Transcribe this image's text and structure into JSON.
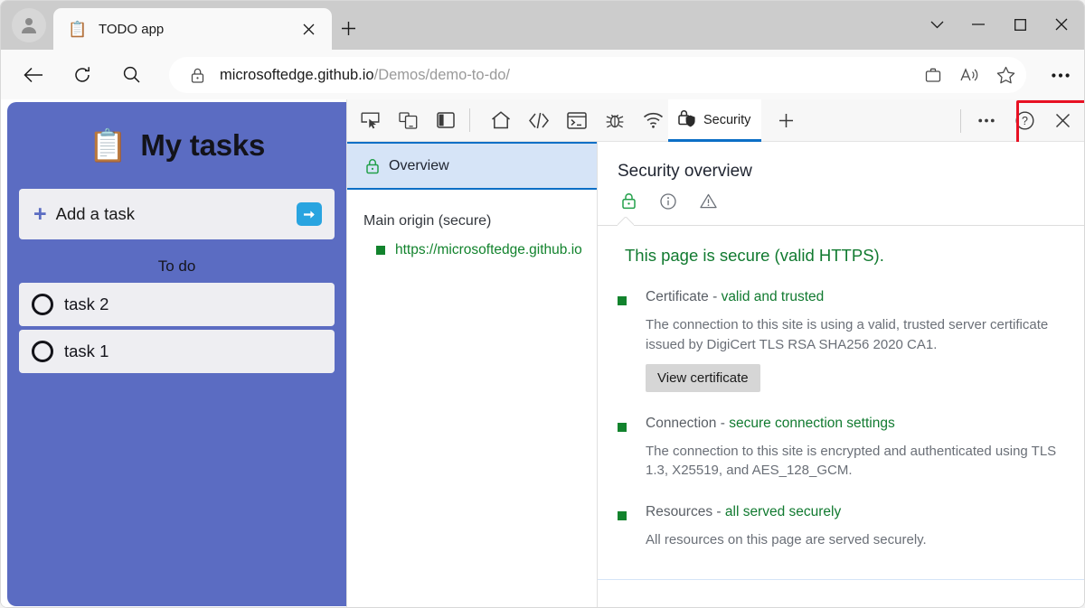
{
  "browser": {
    "profile_icon": "account-avatar-icon",
    "tab": {
      "favicon": "clipboard-icon",
      "title": "TODO app",
      "close_icon": "close-icon"
    },
    "new_tab_label": "+",
    "window_controls": {
      "more_label": "chevron-down-icon",
      "minimize_label": "minimize-icon",
      "maximize_label": "maximize-icon",
      "close_label": "close-icon"
    },
    "toolbar": {
      "back_icon": "back-arrow-icon",
      "reload_icon": "reload-icon",
      "search_icon": "search-icon",
      "url_host": "microsoftedge.github.io",
      "url_path": "/Demos/demo-to-do/",
      "site_lock_icon": "lock-icon",
      "collections_icon": "collections-icon",
      "read_aloud_icon": "read-aloud-icon",
      "favorites_icon": "star-icon",
      "settings_more_icon": "ellipsis-icon"
    }
  },
  "todo_app": {
    "clipboard_emoji": "📋",
    "title": "My tasks",
    "add_task": {
      "plus": "+",
      "label": "Add a task",
      "submit_icon": "arrow-right-icon"
    },
    "section_label": "To do",
    "tasks": [
      {
        "label": "task 2",
        "done": false
      },
      {
        "label": "task 1",
        "done": false
      }
    ]
  },
  "devtools": {
    "toolbar_icons": [
      "inspect-element-icon",
      "device-emulation-icon",
      "dock-side-icon",
      "welcome-home-icon",
      "elements-icon",
      "console-icon",
      "debugger-icon",
      "network-icon"
    ],
    "active_tab": {
      "icon": "security-lock-shield-icon",
      "label": "Security"
    },
    "add_tab_label": "+",
    "more_tools_icon": "ellipsis-icon",
    "help_icon": "help-icon",
    "close_icon": "close-icon",
    "highlight_color": "#e81123",
    "sidebar": {
      "overview": {
        "icon": "lock-icon",
        "label": "Overview"
      },
      "origin_group_title": "Main origin (secure)",
      "origins": [
        {
          "label": "https://microsoftedge.github.io",
          "state_color": "#12832d"
        }
      ]
    },
    "main": {
      "title": "Security overview",
      "status_icons": [
        "lock-secure-icon",
        "info-icon",
        "warning-icon"
      ],
      "headline": "This page is secure (valid HTTPS).",
      "sections": [
        {
          "name": "Certificate",
          "separator": " - ",
          "status": "valid and trusted",
          "description": "The connection to this site is using a valid, trusted server certificate issued by DigiCert TLS RSA SHA256 2020 CA1.",
          "button": "View certificate"
        },
        {
          "name": "Connection",
          "separator": " - ",
          "status": "secure connection settings",
          "description": "The connection to this site is encrypted and authenticated using TLS 1.3, X25519, and AES_128_GCM.",
          "button": null
        },
        {
          "name": "Resources",
          "separator": " - ",
          "status": "all served securely",
          "description": "All resources on this page are served securely.",
          "button": null
        }
      ]
    }
  },
  "colors": {
    "todo_purple": "#5b6cc2",
    "secure_green": "#117a30",
    "accent_blue": "#0c6fc6",
    "highlight_red": "#e81123"
  }
}
